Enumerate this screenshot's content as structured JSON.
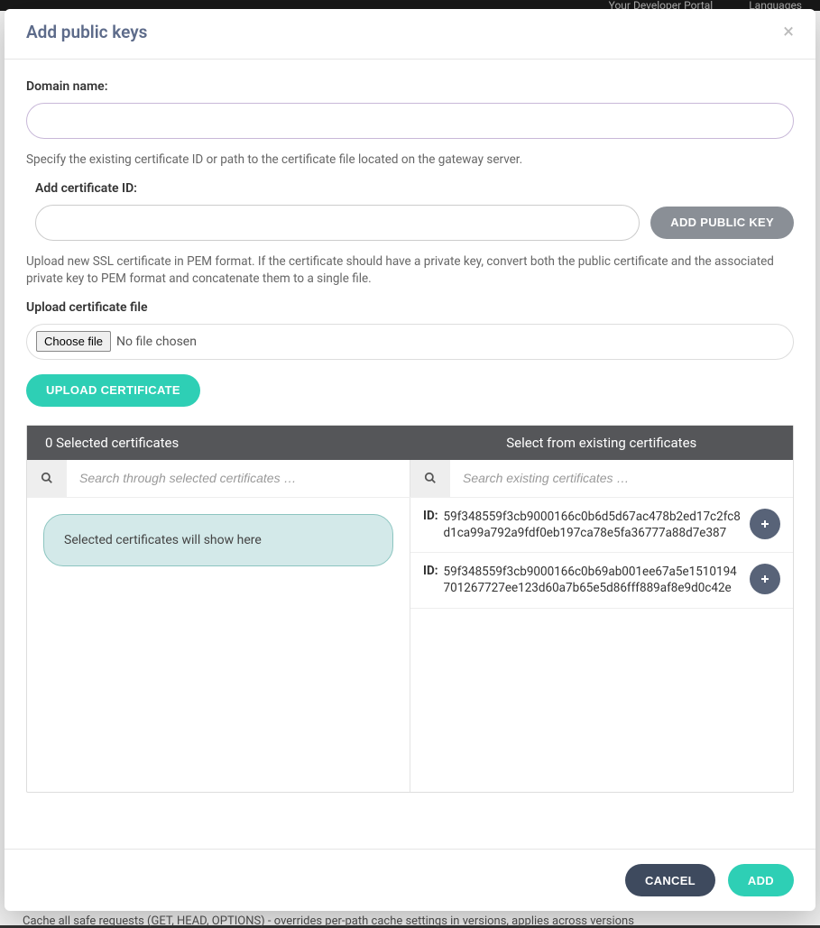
{
  "background": {
    "nav_items": [
      "Your Developer Portal",
      "Languages"
    ],
    "cache_text": "Cache all safe requests (GET, HEAD, OPTIONS) - overrides per-path cache settings in versions, applies across versions"
  },
  "modal": {
    "title": "Add public keys"
  },
  "domain": {
    "label": "Domain name:"
  },
  "help1": "Specify the existing certificate ID or path to the certificate file located on the gateway server.",
  "cert_id": {
    "label": "Add certificate ID:",
    "button": "ADD PUBLIC KEY"
  },
  "help2": "Upload new SSL certificate in PEM format. If the certificate should have a private key, convert both the public certificate and the associated private key to PEM format and concatenate them to a single file.",
  "upload": {
    "label": "Upload certificate file",
    "choose": "Choose file",
    "no_file": "No file chosen",
    "button": "UPLOAD CERTIFICATE"
  },
  "selector": {
    "selected_count": 0,
    "selected_header_tpl": "Selected certificates",
    "existing_header": "Select from existing certificates",
    "search_selected_ph": "Search through selected certificates …",
    "search_existing_ph": "Search existing certificates …",
    "selected_placeholder": "Selected certificates will show here",
    "id_label": "ID:",
    "existing": [
      {
        "id": "59f348559f3cb9000166c0b6d5d67ac478b2ed17c2fc8d1ca99a792a9fdf0eb197ca78e5fa36777a88d7e387"
      },
      {
        "id": "59f348559f3cb9000166c0b69ab001ee67a5e1510194701267727ee123d60a7b65e5d86fff889af8e9d0c42e"
      }
    ]
  },
  "footer": {
    "cancel": "CANCEL",
    "add": "ADD"
  }
}
